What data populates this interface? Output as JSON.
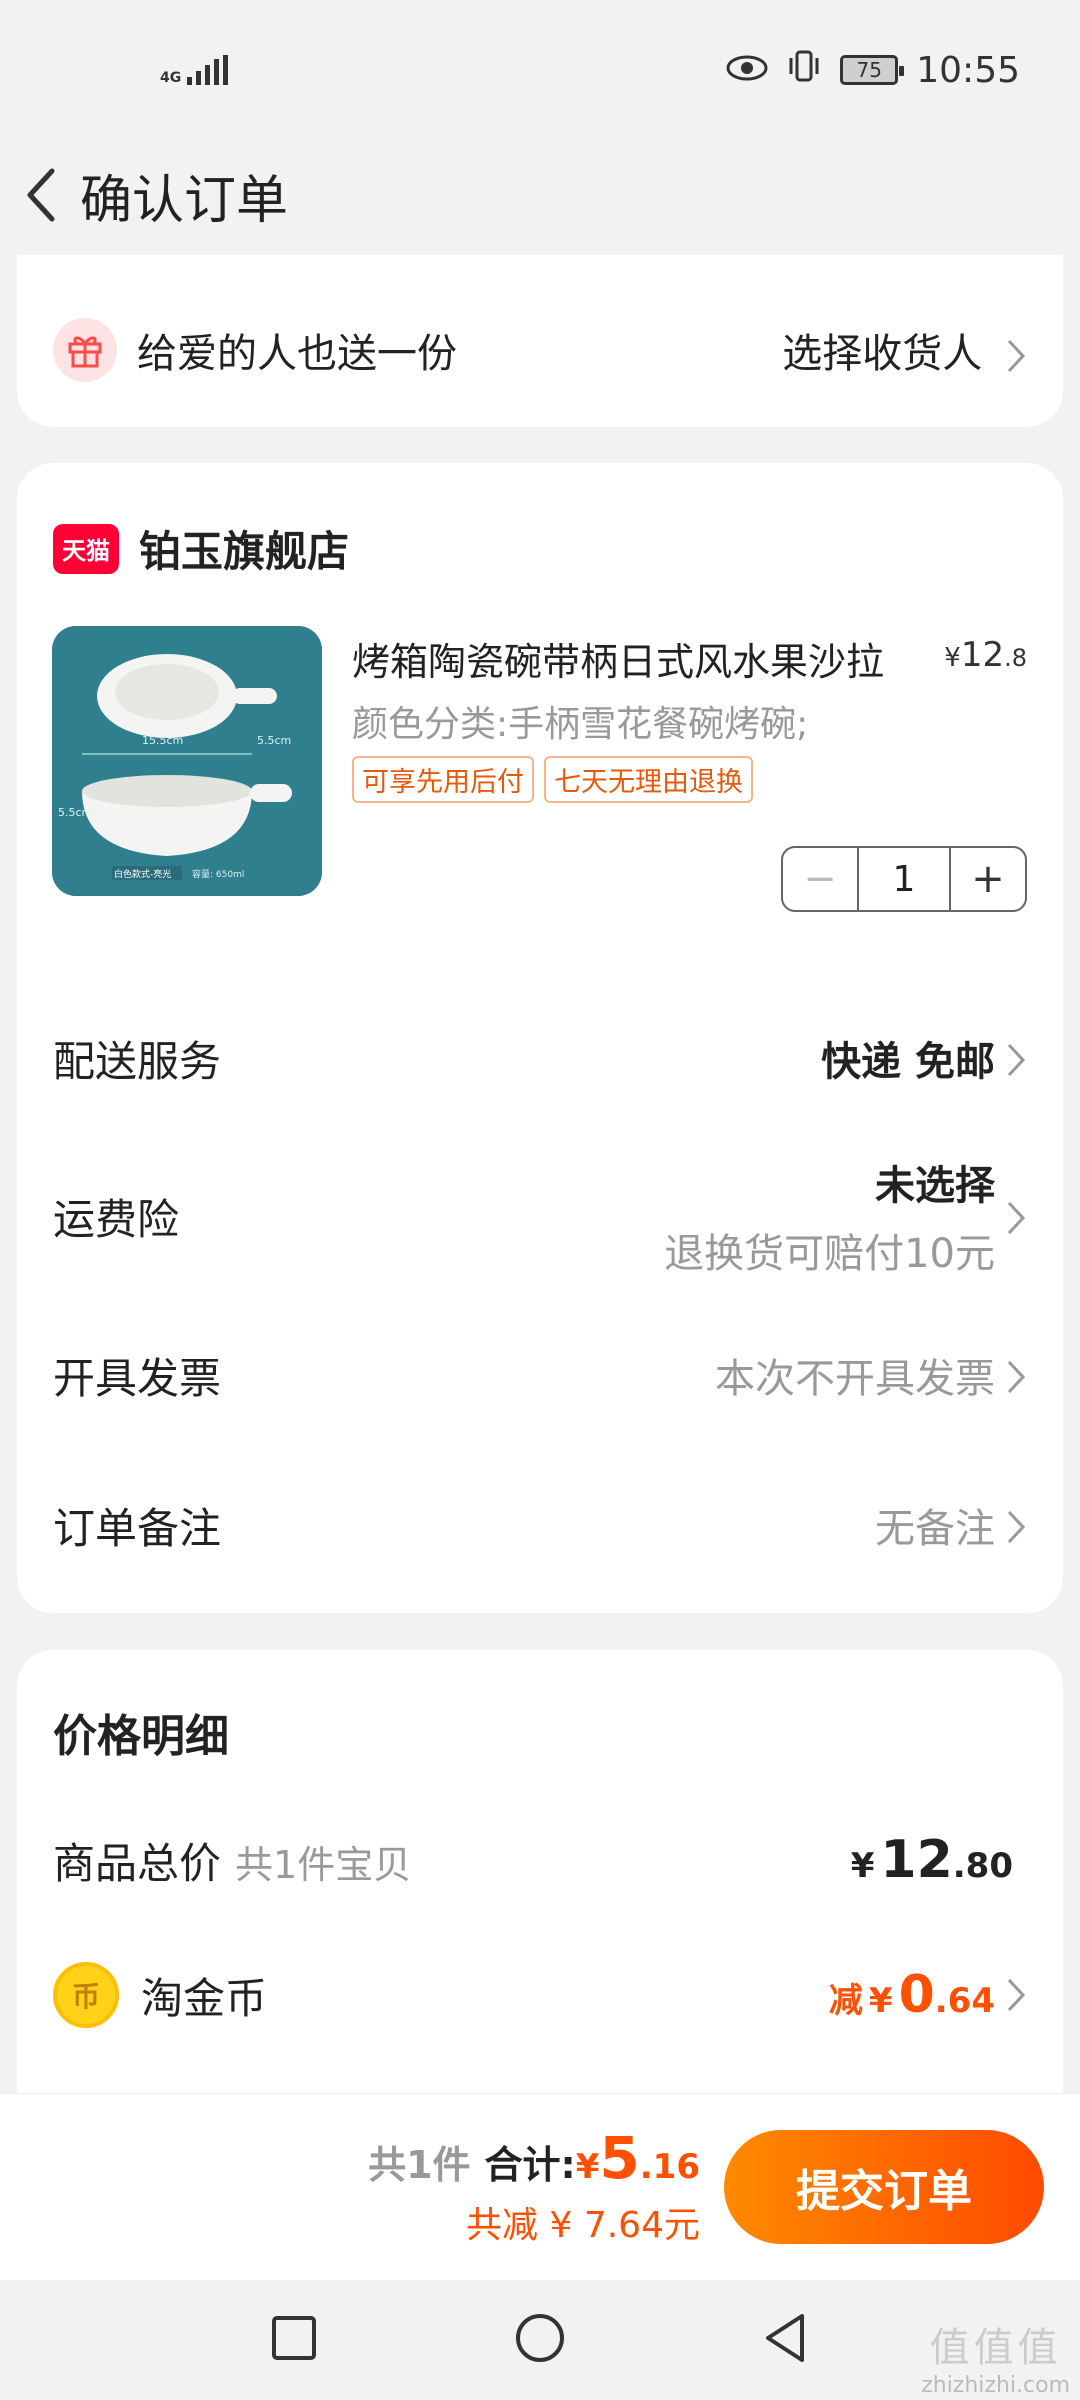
{
  "status_bar": {
    "network": "4G",
    "battery": "75",
    "time": "10:55"
  },
  "header": {
    "title": "确认订单"
  },
  "gift": {
    "label": "给爱的人也送一份",
    "action": "选择收货人"
  },
  "shop": {
    "logo_text": "天猫",
    "name": "铂玉旗舰店"
  },
  "product": {
    "title": "烤箱陶瓷碗带柄日式风水果沙拉",
    "price_symbol": "¥",
    "price_int": "12",
    "price_dec": ".8",
    "sku": "颜色分类:手柄雪花餐碗烤碗;",
    "tags": [
      "可享先用后付",
      "七天无理由退换"
    ],
    "image_labels": {
      "width": "15.5cm",
      "handle": "5.5cm",
      "height": "5.5cm",
      "name": "白色款式-亮光",
      "capacity": "容量: 650ml"
    },
    "quantity": "1",
    "minus": "−",
    "plus": "+"
  },
  "rows": {
    "delivery": {
      "label": "配送服务",
      "value": "快递 免邮"
    },
    "insurance": {
      "label": "运费险",
      "value": "未选择",
      "sub": "退换货可赔付10元"
    },
    "invoice": {
      "label": "开具发票",
      "value": "本次不开具发票"
    },
    "remark": {
      "label": "订单备注",
      "value": "无备注"
    }
  },
  "price_detail": {
    "title": "价格明细",
    "goods_label": "商品总价",
    "goods_count": "共1件宝贝",
    "goods_symbol": "¥",
    "goods_int": "12",
    "goods_dec": ".80",
    "coin_label": "淘金币",
    "coin_icon_text": "币",
    "coin_prefix": "减",
    "coin_symbol": "¥",
    "coin_int": "0",
    "coin_dec": ".64"
  },
  "bottom": {
    "count": "共1件",
    "total_label": "合计:",
    "total_symbol": "¥",
    "total_int": "5",
    "total_dec": ".16",
    "saved": "共减 ¥ 7.64元",
    "submit": "提交订单"
  },
  "watermark": {
    "glyphs": "值值值",
    "site": "zhizhizhi.com"
  },
  "colors": {
    "accent": "#ff5000",
    "tmall": "#ff0036",
    "background": "#f2f2f2"
  },
  "icons": {
    "back": "chevron-left-icon",
    "gift": "gift-icon",
    "chevron": "chevron-right-icon",
    "coin": "coin-icon"
  }
}
